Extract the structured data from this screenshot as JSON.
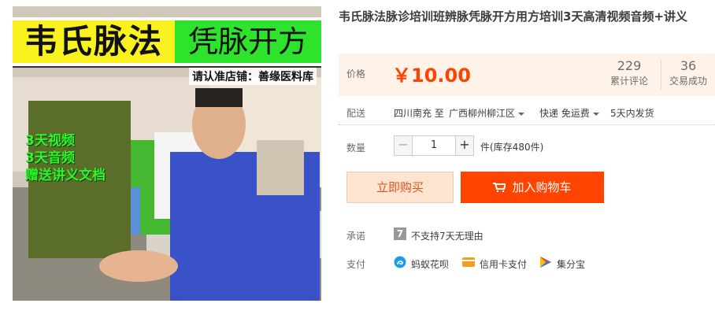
{
  "image": {
    "banner_left": "韦氏脉法",
    "banner_right": "凭脉开方",
    "shop_note": "请认准店铺：善缘医料库",
    "promo_lines": [
      "3天视频",
      "3天音频",
      "赠送讲义文档"
    ]
  },
  "product": {
    "title": "韦氏脉法脉诊培训班辨脉凭脉开方用方培训3天高清视频音频+讲义"
  },
  "price": {
    "label": "价格",
    "value": "￥10.00",
    "reviews_count": "229",
    "reviews_label": "累计评论",
    "deals_count": "36",
    "deals_label": "交易成功"
  },
  "shipping": {
    "label": "配送",
    "from": "四川南充 至",
    "to": "广西柳州柳江区",
    "method": "快递 免运费",
    "ship_time": "5天内发货"
  },
  "quantity": {
    "label": "数量",
    "minus": "−",
    "value": "1",
    "plus": "+",
    "stock": "件(库存480件)"
  },
  "actions": {
    "buy_now": "立即购买",
    "add_to_cart": "加入购物车"
  },
  "promise": {
    "label": "承诺",
    "icon_text": "7",
    "text": "不支持7天无理由"
  },
  "payment": {
    "label": "支付",
    "methods": [
      "蚂蚁花呗",
      "信用卡支付",
      "集分宝"
    ]
  },
  "colors": {
    "accent": "#ff4400",
    "price_bg": "#fff2e8",
    "buy_bg": "#ffe4d0"
  }
}
